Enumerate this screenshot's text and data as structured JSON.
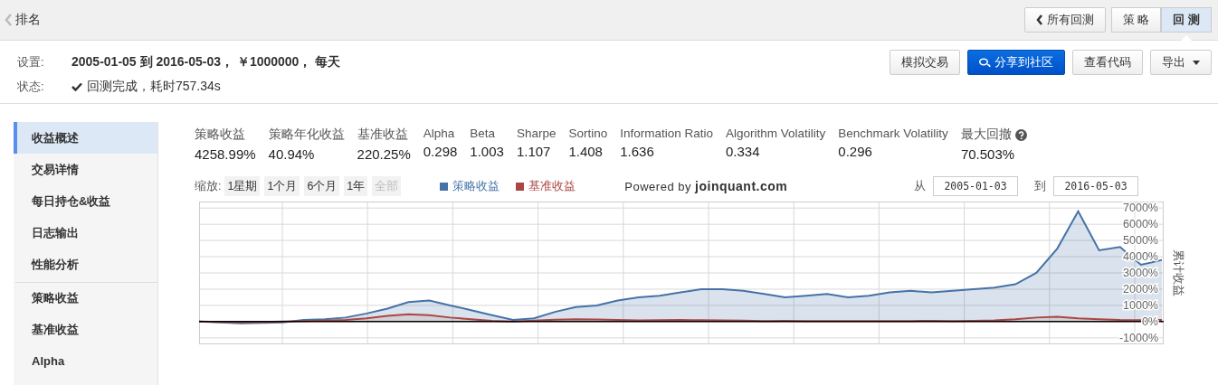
{
  "header": {
    "back_link": "排名",
    "all_backtests_button": "所有回测",
    "tabs": [
      {
        "label": "策 略",
        "selected": false
      },
      {
        "label": "回 测",
        "selected": true
      }
    ]
  },
  "settings": {
    "label": "设置:",
    "value": "2005-01-05 到 2016-05-03， ￥1000000， 每天"
  },
  "status": {
    "label": "状态:",
    "value": "回测完成，耗时757.34s"
  },
  "actions": [
    {
      "kind": "plain",
      "label": "模拟交易"
    },
    {
      "kind": "primary",
      "label": "分享到社区"
    },
    {
      "kind": "plain",
      "label": "查看代码"
    },
    {
      "kind": "dropdown",
      "label": "导出"
    }
  ],
  "sidebar": {
    "items": [
      {
        "label": "收益概述",
        "selected": true
      },
      {
        "label": "交易详情",
        "selected": false
      },
      {
        "label": "每日持仓&收益",
        "selected": false
      },
      {
        "label": "日志输出",
        "selected": false
      },
      {
        "label": "性能分析",
        "selected": false
      },
      {
        "label": "策略收益",
        "selected": false
      },
      {
        "label": "基准收益",
        "selected": false
      },
      {
        "label": "Alpha",
        "selected": false
      }
    ]
  },
  "metrics": [
    {
      "label": "策略收益",
      "value": "4258.99%"
    },
    {
      "label": "策略年化收益",
      "value": "40.94%"
    },
    {
      "label": "基准收益",
      "value": "220.25%"
    },
    {
      "label": "Alpha",
      "value": "0.298"
    },
    {
      "label": "Beta",
      "value": "1.003"
    },
    {
      "label": "Sharpe",
      "value": "1.107"
    },
    {
      "label": "Sortino",
      "value": "1.408"
    },
    {
      "label": "Information Ratio",
      "value": "1.636"
    },
    {
      "label": "Algorithm Volatility",
      "value": "0.334"
    },
    {
      "label": "Benchmark Volatility",
      "value": "0.296"
    },
    {
      "label": "最大回撤",
      "value": "70.503%",
      "help": true
    }
  ],
  "zoom": {
    "label": "缩放:",
    "buttons": [
      {
        "label": "1星期",
        "disabled": false
      },
      {
        "label": "1个月",
        "disabled": false
      },
      {
        "label": "6个月",
        "disabled": false
      },
      {
        "label": "1年",
        "disabled": false
      },
      {
        "label": "全部",
        "disabled": true
      }
    ]
  },
  "powered_by": {
    "prefix": "Powered by",
    "site": "joinquant.com"
  },
  "range": {
    "from_label": "从",
    "from": "2005-01-03",
    "to_label": "到",
    "to": "2016-05-03"
  },
  "chart_data": {
    "type": "area",
    "grid": true,
    "ylabel": "累计收益",
    "ylim": [
      -1400,
      7400
    ],
    "yticks": [
      {
        "value": -1000,
        "label": "-1000%"
      },
      {
        "value": 0,
        "label": "0%"
      },
      {
        "value": 1000,
        "label": "1000%"
      },
      {
        "value": 2000,
        "label": "2000%"
      },
      {
        "value": 3000,
        "label": "3000%"
      },
      {
        "value": 4000,
        "label": "4000%"
      },
      {
        "value": 5000,
        "label": "5000%"
      },
      {
        "value": 6000,
        "label": "6000%"
      },
      {
        "value": 7000,
        "label": "7000%"
      }
    ],
    "series": [
      {
        "name": "策略收益",
        "color": "#4572a7",
        "values": [
          0,
          -50,
          -100,
          -80,
          -50,
          100,
          150,
          250,
          500,
          800,
          1200,
          1300,
          1000,
          700,
          400,
          100,
          200,
          600,
          900,
          1000,
          1300,
          1500,
          1600,
          1800,
          2000,
          2000,
          1900,
          1700,
          1500,
          1600,
          1700,
          1500,
          1600,
          1800,
          1900,
          1800,
          1900,
          2000,
          2100,
          2300,
          3000,
          4500,
          6800,
          4400,
          4600,
          3500,
          3800
        ]
      },
      {
        "name": "基准收益",
        "color": "#aa4643",
        "values": [
          0,
          -20,
          -30,
          -20,
          0,
          40,
          60,
          100,
          200,
          350,
          450,
          400,
          250,
          150,
          50,
          0,
          60,
          120,
          150,
          130,
          110,
          80,
          90,
          100,
          90,
          80,
          60,
          40,
          50,
          40,
          30,
          40,
          40,
          30,
          40,
          50,
          40,
          50,
          80,
          150,
          250,
          300,
          200,
          150,
          100,
          90,
          110
        ]
      }
    ]
  }
}
